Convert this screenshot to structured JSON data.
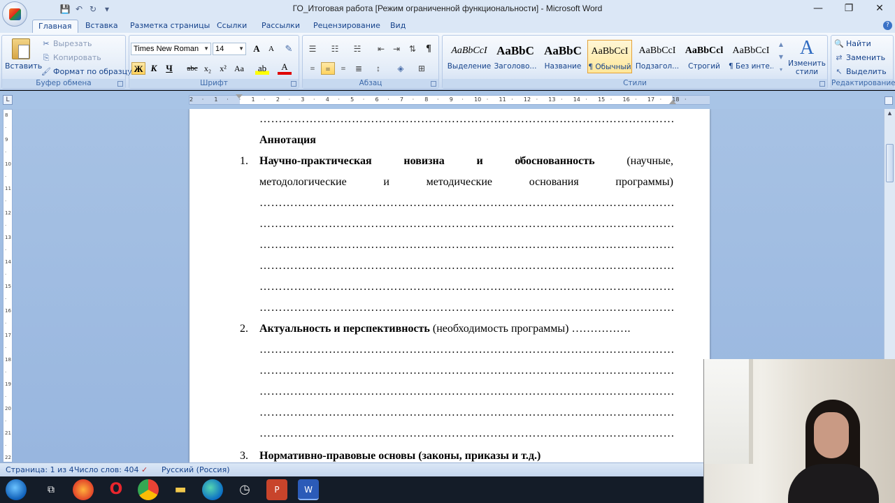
{
  "window": {
    "title": "ГО_Итоговая работа [Режим ограниченной функциональности] - Microsoft Word",
    "minimize": "—",
    "restore": "❐",
    "close": "✕"
  },
  "qat": {
    "save": "💾",
    "undo": "↶",
    "redo": "↻",
    "more": "▾"
  },
  "tabs": [
    {
      "label": "Главная",
      "active": true
    },
    {
      "label": "Вставка"
    },
    {
      "label": "Разметка страницы"
    },
    {
      "label": "Ссылки"
    },
    {
      "label": "Рассылки"
    },
    {
      "label": "Рецензирование"
    },
    {
      "label": "Вид"
    }
  ],
  "ribbon": {
    "clipboard": {
      "label": "Буфер обмена",
      "paste": "Вставить",
      "cut": "Вырезать",
      "copy": "Копировать",
      "format_painter": "Формат по образцу"
    },
    "font": {
      "label": "Шрифт",
      "font_name": "Times New Roman",
      "font_size": "14",
      "bold": "Ж",
      "italic": "К",
      "underline": "Ч",
      "strike": "abc",
      "subscript": "x₂",
      "superscript": "x²",
      "case": "Aa",
      "grow": "A",
      "shrink": "A"
    },
    "paragraph": {
      "label": "Абзац",
      "pilcrow": "¶"
    },
    "styles": {
      "label": "Стили",
      "items": [
        {
          "sample": "AaBbCcI",
          "name": "Выделение"
        },
        {
          "sample": "AaBbC",
          "name": "Заголово..."
        },
        {
          "sample": "AaBbC",
          "name": "Название"
        },
        {
          "sample": "AaBbCcI",
          "name": "¶ Обычный",
          "active": true
        },
        {
          "sample": "AaBbCcI",
          "name": "Подзагол..."
        },
        {
          "sample": "AaBbCcl",
          "name": "Строгий"
        },
        {
          "sample": "AaBbCcI",
          "name": "¶ Без инте..."
        }
      ],
      "change_styles": "Изменить стили"
    },
    "editing": {
      "label": "Редактирование",
      "find": "Найти",
      "replace": "Заменить",
      "select": "Выделить"
    }
  },
  "document": {
    "top_dots": "………………………………………………………………………………………………………………",
    "annotation": "Аннотация",
    "item1": {
      "num": "1.",
      "words": [
        "Научно-практическая",
        "новизна",
        "и",
        "обоснованность",
        "(научные,"
      ],
      "line2": [
        "методологические",
        "и",
        "методические",
        "основания",
        "программы)"
      ]
    },
    "dot_line": "………………………………………………………………………………………………………………",
    "item2": {
      "num": "2.",
      "bold": "Актуальность и перспективность",
      "normal": " (необходимость программы) ……………."
    },
    "item3": {
      "num": "3.",
      "bold": "Нормативно-правовые основы (законы, приказы и т.д.)"
    }
  },
  "status": {
    "page": "Страница: 1 из 4",
    "words": "Число слов: 404",
    "language": "Русский (Россия)"
  }
}
